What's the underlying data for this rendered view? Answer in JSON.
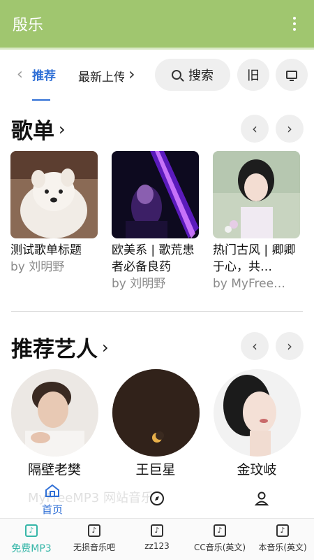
{
  "app": {
    "title": "殷乐"
  },
  "tabs": {
    "active": "推荐",
    "next": "最新上传",
    "prev_arrow": "‹",
    "next_arrow": "›"
  },
  "toolbar": {
    "search_label": "搜索",
    "old_label": "旧"
  },
  "playlists": {
    "title": "歌单",
    "chevron": "›",
    "prev_btn": "‹",
    "next_btn": "›",
    "items": [
      {
        "title": "测试歌单标题",
        "author": "by 刘明野"
      },
      {
        "title": "欧美系 | 歌荒患者必备良药",
        "author": "by 刘明野"
      },
      {
        "title": "热门古风 | 卿卿于心，共…",
        "author": "by MyFree…"
      }
    ]
  },
  "artists": {
    "title": "推荐艺人",
    "chevron": "›",
    "prev_btn": "‹",
    "next_btn": "›",
    "items": [
      {
        "name": "隔壁老樊"
      },
      {
        "name": "王巨星"
      },
      {
        "name": "金玟岐"
      }
    ]
  },
  "page_tabs": {
    "home_label": "首页",
    "faint_text": "MyFreeMP3 网站音乐"
  },
  "bottom_nav": {
    "items": [
      {
        "label": "免费MP3",
        "icon": "music-note-icon",
        "active": true
      },
      {
        "label": "无损音乐吧",
        "icon": "music-note-icon",
        "active": false
      },
      {
        "label": "zz123",
        "icon": "music-note-icon",
        "active": false
      },
      {
        "label": "CC音乐(英文)",
        "icon": "music-note-icon",
        "active": false
      },
      {
        "label": "本音乐(英文)",
        "icon": "music-note-icon",
        "active": false
      }
    ]
  },
  "colors": {
    "appbar": "#a0c66f",
    "accent_blue": "#2f6fd6",
    "accent_teal": "#36b6a8"
  }
}
